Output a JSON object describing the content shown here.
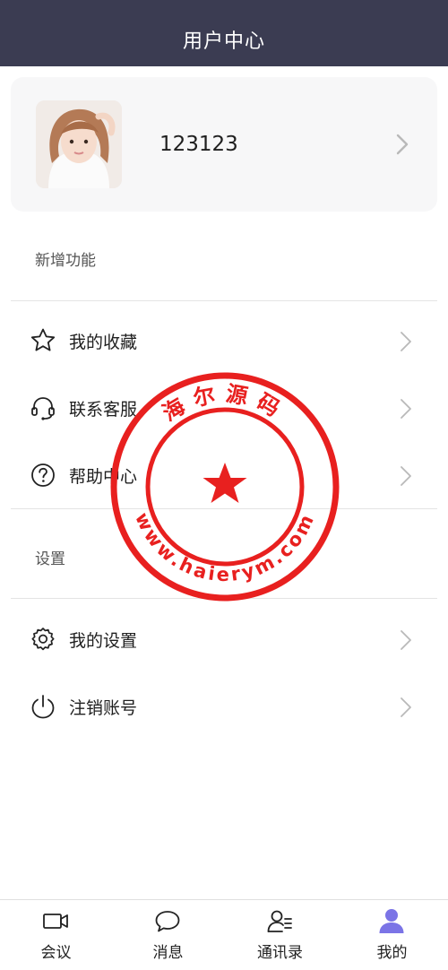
{
  "header": {
    "title": "用户中心"
  },
  "profile": {
    "username": "123123"
  },
  "sections": {
    "new_features": "新增功能",
    "settings": "设置"
  },
  "menu": {
    "favorites": "我的收藏",
    "customer_service": "联系客服",
    "help_center": "帮助中心",
    "my_settings": "我的设置",
    "logout": "注销账号"
  },
  "watermark": {
    "top_text": "海尔源码",
    "bottom_text": "www.haierym.com"
  },
  "tabs": [
    {
      "label": "会议",
      "icon": "video-camera-icon",
      "active": false
    },
    {
      "label": "消息",
      "icon": "chat-bubble-icon",
      "active": false
    },
    {
      "label": "通讯录",
      "icon": "contacts-icon",
      "active": false
    },
    {
      "label": "我的",
      "icon": "user-icon",
      "active": true
    }
  ],
  "colors": {
    "header_bg": "#3b3c52",
    "accent": "#7b74e6",
    "stamp_red": "#e8201f"
  }
}
